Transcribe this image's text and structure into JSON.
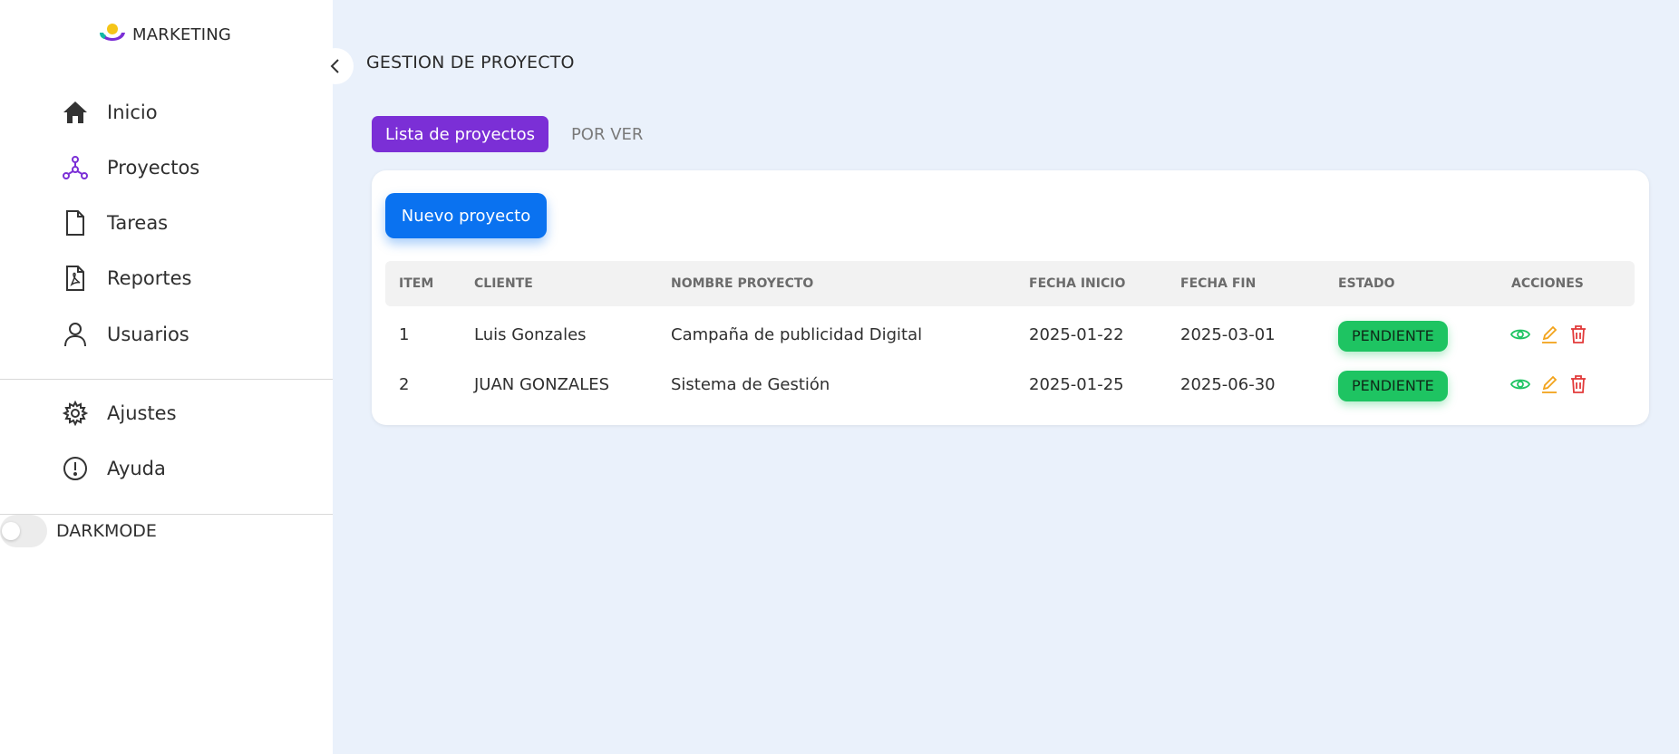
{
  "brand": {
    "name": "MARKETING"
  },
  "sidebar": {
    "items": [
      {
        "label": "Inicio",
        "icon": "home-icon"
      },
      {
        "label": "Proyectos",
        "icon": "hub-icon"
      },
      {
        "label": "Tareas",
        "icon": "file-icon"
      },
      {
        "label": "Reportes",
        "icon": "pdf-file-icon"
      },
      {
        "label": "Usuarios",
        "icon": "user-icon"
      }
    ],
    "secondary": [
      {
        "label": "Ajustes",
        "icon": "gear-icon"
      },
      {
        "label": "Ayuda",
        "icon": "alert-circle-icon"
      }
    ],
    "darkmode_label": "DARKMODE"
  },
  "page": {
    "title": "GESTION DE PROYECTO"
  },
  "tabs": [
    {
      "label": "Lista de proyectos",
      "active": true
    },
    {
      "label": "POR VER",
      "active": false
    }
  ],
  "toolbar": {
    "new_label": "Nuevo proyecto"
  },
  "table": {
    "headers": [
      "ITEM",
      "CLIENTE",
      "NOMBRE PROYECTO",
      "FECHA INICIO",
      "FECHA FIN",
      "ESTADO",
      "ACCIONES"
    ],
    "rows": [
      {
        "item": "1",
        "cliente": "Luis Gonzales",
        "nombre": "Campaña de publicidad Digital",
        "inicio": "2025-01-22",
        "fin": "2025-03-01",
        "estado": "PENDIENTE"
      },
      {
        "item": "2",
        "cliente": "JUAN GONZALES",
        "nombre": "Sistema de Gestión",
        "inicio": "2025-01-25",
        "fin": "2025-06-30",
        "estado": "PENDIENTE"
      }
    ]
  },
  "colors": {
    "accent_purple": "#7b2fd6",
    "primary_blue": "#0a72f0",
    "status_green": "#1ec462",
    "view_green": "#1ec462",
    "edit_orange": "#f2a31b",
    "delete_red": "#e23b3b"
  }
}
